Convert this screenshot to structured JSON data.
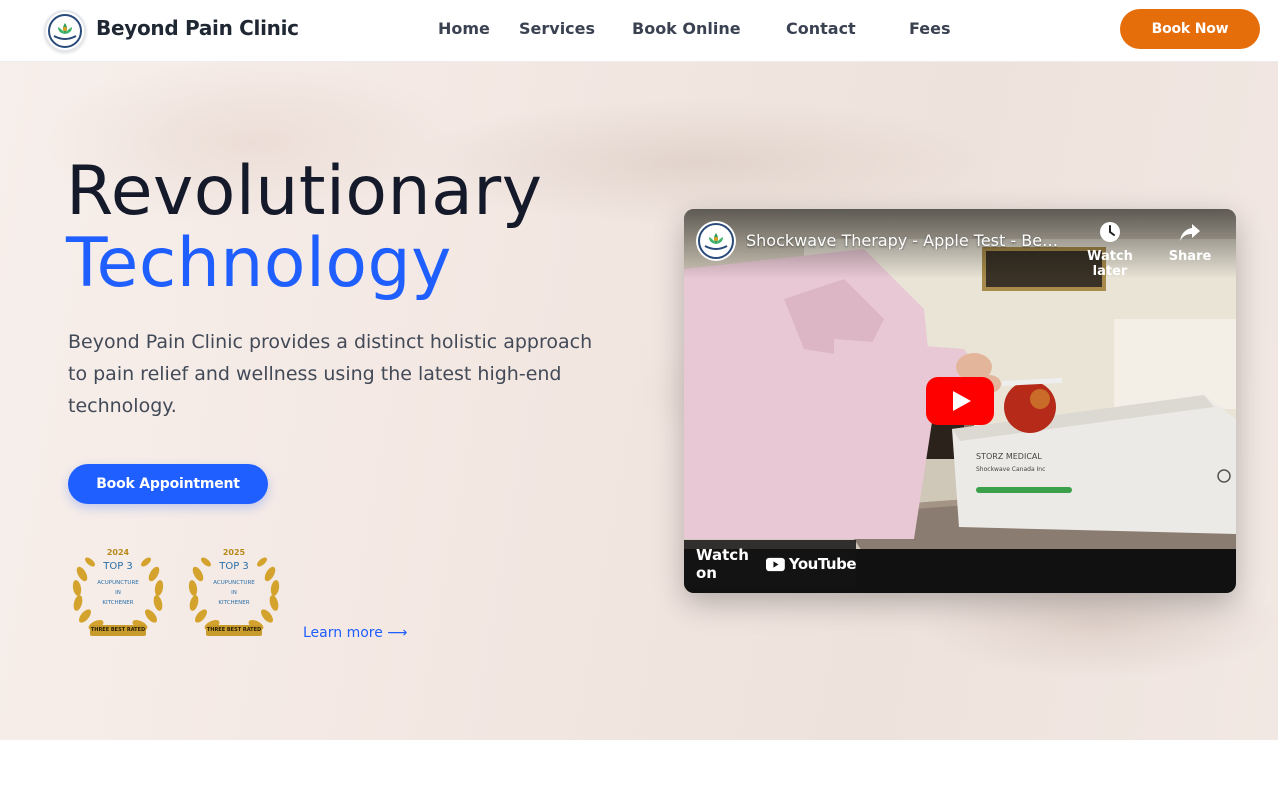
{
  "header": {
    "brand": "Beyond Pain Clinic",
    "logo_icon": "lotus-logo-icon",
    "nav": [
      "Home",
      "Services",
      "Book Online",
      "Contact",
      "Fees"
    ],
    "cta": "Book Now"
  },
  "hero": {
    "title_line1": "Revolutionary",
    "title_line2": "Technology",
    "description": "Beyond Pain Clinic provides a distinct holistic approach to pain relief and wellness using the latest high-end technology.",
    "cta": "Book Appointment",
    "learn_more": "Learn more ⟶",
    "badges": [
      {
        "year": "2024",
        "rank": "TOP 3",
        "line1": "ACUPUNCTURE",
        "line2": "IN",
        "line3": "KITCHENER",
        "ribbon": "THREE BEST RATED"
      },
      {
        "year": "2025",
        "rank": "TOP 3",
        "line1": "ACUPUNCTURE",
        "line2": "IN",
        "line3": "KITCHENER",
        "ribbon": "THREE BEST RATED"
      }
    ]
  },
  "video": {
    "title": "Shockwave Therapy - Apple Test - Beyond Pain Clinic",
    "watch_later": "Watch later",
    "share": "Share",
    "watch_on": "Watch on",
    "youtube": "YouTube",
    "device_brand": "STORZ MEDICAL",
    "device_sub": "Shockwave Canada Inc"
  },
  "colors": {
    "accent_blue": "#1f5eff",
    "accent_orange": "#e56d0a",
    "youtube_red": "#ff0000"
  }
}
